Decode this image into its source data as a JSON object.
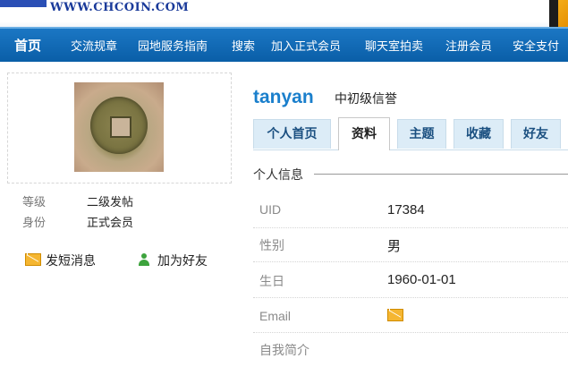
{
  "header": {
    "logo_url": "WWW.CHCOIN.COM"
  },
  "nav": {
    "items": [
      "首页",
      "交流规章",
      "园地服务指南",
      "搜索",
      "加入正式会员",
      "聊天室拍卖",
      "注册会员",
      "安全支付"
    ]
  },
  "profile": {
    "avatar_icon": "coin-avatar",
    "stats": [
      {
        "label": "等级",
        "value": "二级发帖"
      },
      {
        "label": "身份",
        "value": "正式会员"
      }
    ],
    "actions": {
      "message": "发短消息",
      "add_friend": "加为好友"
    }
  },
  "user": {
    "name": "tanyan",
    "credit": "中初级信誉"
  },
  "tabs": [
    "个人首页",
    "资料",
    "主题",
    "收藏",
    "好友"
  ],
  "active_tab": "资料",
  "section_title": "个人信息",
  "fields": [
    {
      "label": "UID",
      "value": "17384"
    },
    {
      "label": "性别",
      "value": "男"
    },
    {
      "label": "生日",
      "value": "1960-01-01"
    },
    {
      "label": "Email",
      "value": "",
      "icon": "mail-icon"
    },
    {
      "label": "自我简介",
      "value": ""
    }
  ],
  "colors": {
    "nav_bg": "#0a5ea7",
    "username": "#1a7fcc",
    "tab_bg": "#dcecf7"
  }
}
